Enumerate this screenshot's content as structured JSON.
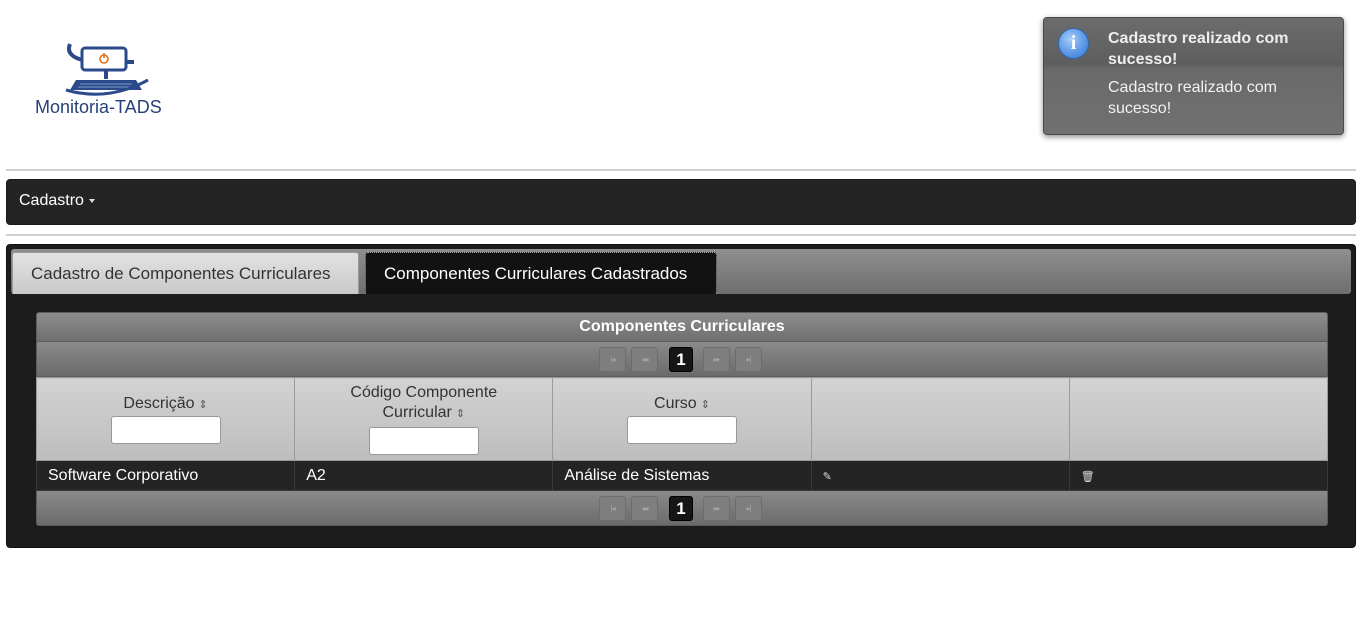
{
  "logo": {
    "text": "Monitoria-TADS"
  },
  "notification": {
    "title": "Cadastro realizado com sucesso!",
    "message": "Cadastro realizado com sucesso!",
    "icon": "info-icon"
  },
  "menu": {
    "cadastro_label": "Cadastro"
  },
  "tabs": [
    {
      "label": "Cadastro de Componentes Curriculares",
      "active": false
    },
    {
      "label": "Componentes Curriculares Cadastrados",
      "active": true
    }
  ],
  "datatable": {
    "title": "Componentes Curriculares",
    "columns": [
      {
        "label": "Descrição",
        "sortable": true,
        "filter": ""
      },
      {
        "label": "Código Componente Curricular",
        "sortable": true,
        "filter": ""
      },
      {
        "label": "Curso",
        "sortable": true,
        "filter": ""
      },
      {
        "label": "",
        "sortable": false
      },
      {
        "label": "",
        "sortable": false
      }
    ],
    "rows": [
      {
        "descricao": "Software Corporativo",
        "codigo": "A2",
        "curso": "Análise de Sistemas",
        "edit_icon": "pencil-icon",
        "delete_icon": "trash-icon"
      }
    ],
    "paginator": {
      "current_page": "1",
      "first": "|◂",
      "prev": "◂◂",
      "next": "▸▸",
      "last": "▸|"
    }
  }
}
